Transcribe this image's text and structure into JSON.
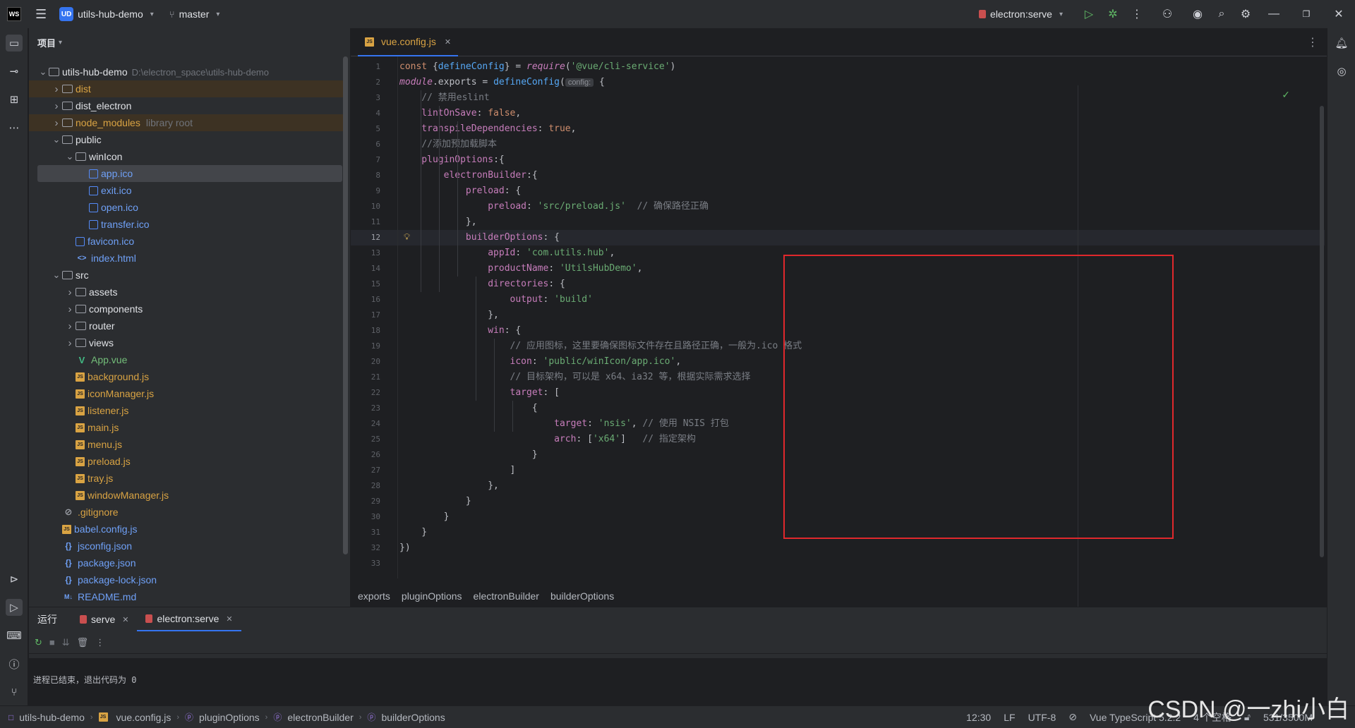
{
  "titlebar": {
    "logo": "WS",
    "project_badge": "UD",
    "project_name": "utils-hub-demo",
    "branch": "master",
    "run_config": "electron:serve"
  },
  "project_panel": {
    "title": "项目",
    "tree": [
      {
        "label": "utils-hub-demo",
        "extra": "D:\\electron_space\\utils-hub-demo",
        "depth": 0,
        "type": "folder",
        "open": true
      },
      {
        "label": "dist",
        "depth": 1,
        "type": "folder",
        "open": false,
        "color": "orange"
      },
      {
        "label": "dist_electron",
        "depth": 1,
        "type": "folder",
        "open": false
      },
      {
        "label": "node_modules",
        "extra": "library root",
        "depth": 1,
        "type": "folder",
        "open": false,
        "color": "orange"
      },
      {
        "label": "public",
        "depth": 1,
        "type": "folder",
        "open": true
      },
      {
        "label": "winIcon",
        "depth": 2,
        "type": "folder",
        "open": true
      },
      {
        "label": "app.ico",
        "depth": 3,
        "type": "ico",
        "color": "blue",
        "selected": true
      },
      {
        "label": "exit.ico",
        "depth": 3,
        "type": "ico",
        "color": "blue"
      },
      {
        "label": "open.ico",
        "depth": 3,
        "type": "ico",
        "color": "blue"
      },
      {
        "label": "transfer.ico",
        "depth": 3,
        "type": "ico",
        "color": "blue"
      },
      {
        "label": "favicon.ico",
        "depth": 2,
        "type": "ico",
        "color": "blue"
      },
      {
        "label": "index.html",
        "depth": 2,
        "type": "html",
        "color": "blue"
      },
      {
        "label": "src",
        "depth": 1,
        "type": "folder",
        "open": true
      },
      {
        "label": "assets",
        "depth": 2,
        "type": "folder",
        "open": false
      },
      {
        "label": "components",
        "depth": 2,
        "type": "folder",
        "open": false
      },
      {
        "label": "router",
        "depth": 2,
        "type": "folder",
        "open": false
      },
      {
        "label": "views",
        "depth": 2,
        "type": "folder",
        "open": false
      },
      {
        "label": "App.vue",
        "depth": 2,
        "type": "vue",
        "color": "green"
      },
      {
        "label": "background.js",
        "depth": 2,
        "type": "js",
        "color": "orange"
      },
      {
        "label": "iconManager.js",
        "depth": 2,
        "type": "js",
        "color": "orange"
      },
      {
        "label": "listener.js",
        "depth": 2,
        "type": "js",
        "color": "orange"
      },
      {
        "label": "main.js",
        "depth": 2,
        "type": "js",
        "color": "orange"
      },
      {
        "label": "menu.js",
        "depth": 2,
        "type": "js",
        "color": "orange"
      },
      {
        "label": "preload.js",
        "depth": 2,
        "type": "js",
        "color": "orange"
      },
      {
        "label": "tray.js",
        "depth": 2,
        "type": "js",
        "color": "orange"
      },
      {
        "label": "windowManager.js",
        "depth": 2,
        "type": "js",
        "color": "orange"
      },
      {
        "label": ".gitignore",
        "depth": 1,
        "type": "git",
        "color": "orange"
      },
      {
        "label": "babel.config.js",
        "depth": 1,
        "type": "js",
        "color": "blue"
      },
      {
        "label": "jsconfig.json",
        "depth": 1,
        "type": "json",
        "color": "blue"
      },
      {
        "label": "package.json",
        "depth": 1,
        "type": "json",
        "color": "blue"
      },
      {
        "label": "package-lock.json",
        "depth": 1,
        "type": "json",
        "color": "blue"
      },
      {
        "label": "README.md",
        "depth": 1,
        "type": "md",
        "color": "blue"
      }
    ]
  },
  "editor": {
    "tab_label": "vue.config.js",
    "current_line": 12,
    "code_lines": [
      [
        [
          "kw",
          "const "
        ],
        [
          "",
          "{"
        ],
        [
          "fn",
          "defineConfig"
        ],
        [
          "",
          "} = "
        ],
        [
          "it",
          "require"
        ],
        [
          "",
          "("
        ],
        [
          "st",
          "'@vue/cli-service'"
        ],
        [
          "",
          ")"
        ]
      ],
      [
        [
          "it",
          "module"
        ],
        [
          "",
          ".exports = "
        ],
        [
          "fn",
          "defineConfig"
        ],
        [
          "",
          "("
        ],
        [
          "hint",
          "config:"
        ],
        [
          "",
          " {"
        ]
      ],
      [
        [
          "cm",
          "    // 禁用eslint"
        ]
      ],
      [
        [
          "pr",
          "    lintOnSave"
        ],
        [
          "",
          ": "
        ],
        [
          "kw",
          "false"
        ],
        [
          "",
          ","
        ]
      ],
      [
        [
          "pr",
          "    transpileDependencies"
        ],
        [
          "",
          ": "
        ],
        [
          "kw",
          "true"
        ],
        [
          "",
          ","
        ]
      ],
      [
        [
          "cm",
          "    //添加预加载脚本"
        ]
      ],
      [
        [
          "pr",
          "    pluginOptions"
        ],
        [
          "",
          ":{"
        ]
      ],
      [
        [
          "pr",
          "        electronBuilder"
        ],
        [
          "",
          ":{"
        ]
      ],
      [
        [
          "pr",
          "            preload"
        ],
        [
          "",
          ": {"
        ]
      ],
      [
        [
          "pr",
          "                preload"
        ],
        [
          "",
          ": "
        ],
        [
          "st",
          "'src/preload.js'"
        ],
        [
          "",
          "  "
        ],
        [
          "cm",
          "// 确保路径正确"
        ]
      ],
      [
        [
          "",
          "            },"
        ]
      ],
      [
        [
          "pr",
          "            builderOptions"
        ],
        [
          "",
          ": {"
        ]
      ],
      [
        [
          "pr",
          "                appId"
        ],
        [
          "",
          ": "
        ],
        [
          "st",
          "'com.utils.hub'"
        ],
        [
          "",
          ","
        ]
      ],
      [
        [
          "pr",
          "                productName"
        ],
        [
          "",
          ": "
        ],
        [
          "st",
          "'UtilsHubDemo'"
        ],
        [
          "",
          ","
        ]
      ],
      [
        [
          "pr",
          "                directories"
        ],
        [
          "",
          ": {"
        ]
      ],
      [
        [
          "pr",
          "                    output"
        ],
        [
          "",
          ": "
        ],
        [
          "st",
          "'build'"
        ]
      ],
      [
        [
          "",
          "                },"
        ]
      ],
      [
        [
          "pr",
          "                win"
        ],
        [
          "",
          ": {"
        ]
      ],
      [
        [
          "cm",
          "                    // 应用图标，这里要确保图标文件存在且路径正确，一般为.ico 格式"
        ]
      ],
      [
        [
          "pr",
          "                    icon"
        ],
        [
          "",
          ": "
        ],
        [
          "st",
          "'public/winIcon/app.ico'"
        ],
        [
          "",
          ","
        ]
      ],
      [
        [
          "cm",
          "                    // 目标架构，可以是 x64、ia32 等，根据实际需求选择"
        ]
      ],
      [
        [
          "pr",
          "                    target"
        ],
        [
          "",
          ": ["
        ]
      ],
      [
        [
          "",
          "                        {"
        ]
      ],
      [
        [
          "pr",
          "                            target"
        ],
        [
          "",
          ": "
        ],
        [
          "st",
          "'nsis'"
        ],
        [
          "",
          ", "
        ],
        [
          "cm",
          "// 使用 NSIS 打包"
        ]
      ],
      [
        [
          "pr",
          "                            arch"
        ],
        [
          "",
          ": ["
        ],
        [
          "st",
          "'x64'"
        ],
        [
          "",
          "]   "
        ],
        [
          "cm",
          "// 指定架构"
        ]
      ],
      [
        [
          "",
          "                        }"
        ]
      ],
      [
        [
          "",
          "                    ]"
        ]
      ],
      [
        [
          "",
          "                },"
        ]
      ],
      [
        [
          "",
          "            }"
        ]
      ],
      [
        [
          "",
          "        }"
        ]
      ],
      [
        [
          "",
          "    }"
        ]
      ],
      [
        [
          "",
          "})"
        ]
      ],
      [
        [
          "",
          ""
        ]
      ]
    ],
    "breadcrumbs": [
      "exports",
      "pluginOptions",
      "electronBuilder",
      "builderOptions"
    ]
  },
  "run_panel": {
    "title": "运行",
    "tabs": [
      {
        "label": "serve",
        "active": false
      },
      {
        "label": "electron:serve",
        "active": true
      }
    ],
    "output": "进程已结束，退出代码为 0"
  },
  "status_bar": {
    "path": [
      "utils-hub-demo",
      "vue.config.js",
      "pluginOptions",
      "electronBuilder",
      "builderOptions"
    ],
    "position": "12:30",
    "line_ending": "LF",
    "encoding": "UTF-8",
    "language": "Vue TypeScript 5.2.2",
    "indent": "4 个空格",
    "memory": "531/3500M"
  },
  "watermark": "CSDN @一zhi小白",
  "colors": {
    "accent": "#3574f0",
    "annotation_box": "#e0282c"
  }
}
